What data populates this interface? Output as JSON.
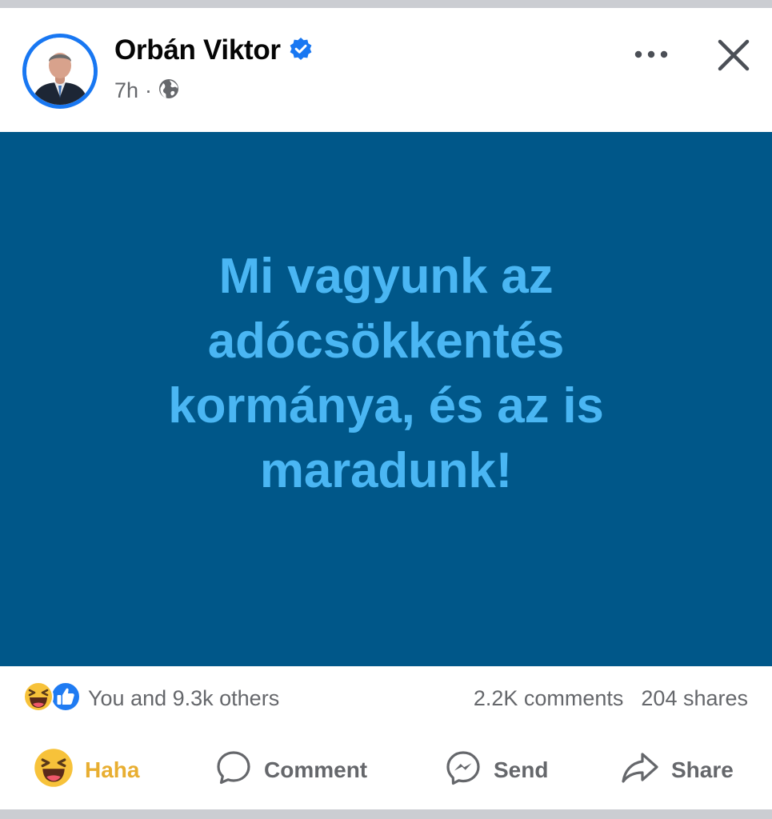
{
  "post": {
    "author": "Orbán Viktor",
    "verified": true,
    "time": "7h",
    "separator": "·",
    "audience_icon": "globe-icon",
    "image_text": "Mi vagyunk az adócsökkentés kormánya, és az is maradunk!"
  },
  "header": {
    "more_icon": "more-options-icon",
    "close_icon": "close-icon"
  },
  "stats": {
    "reaction_icons": [
      "haha-reaction-icon",
      "like-reaction-icon"
    ],
    "reaction_text": "You and 9.3k others",
    "comments": "2.2K comments",
    "shares": "204 shares"
  },
  "actions": {
    "haha_label": "Haha",
    "comment_label": "Comment",
    "send_label": "Send",
    "share_label": "Share"
  },
  "colors": {
    "accent": "#1877f2",
    "image_background": "#005789",
    "image_text": "#4ab6f3",
    "haha_active": "#e8ae31",
    "secondary_text": "#65676b"
  }
}
